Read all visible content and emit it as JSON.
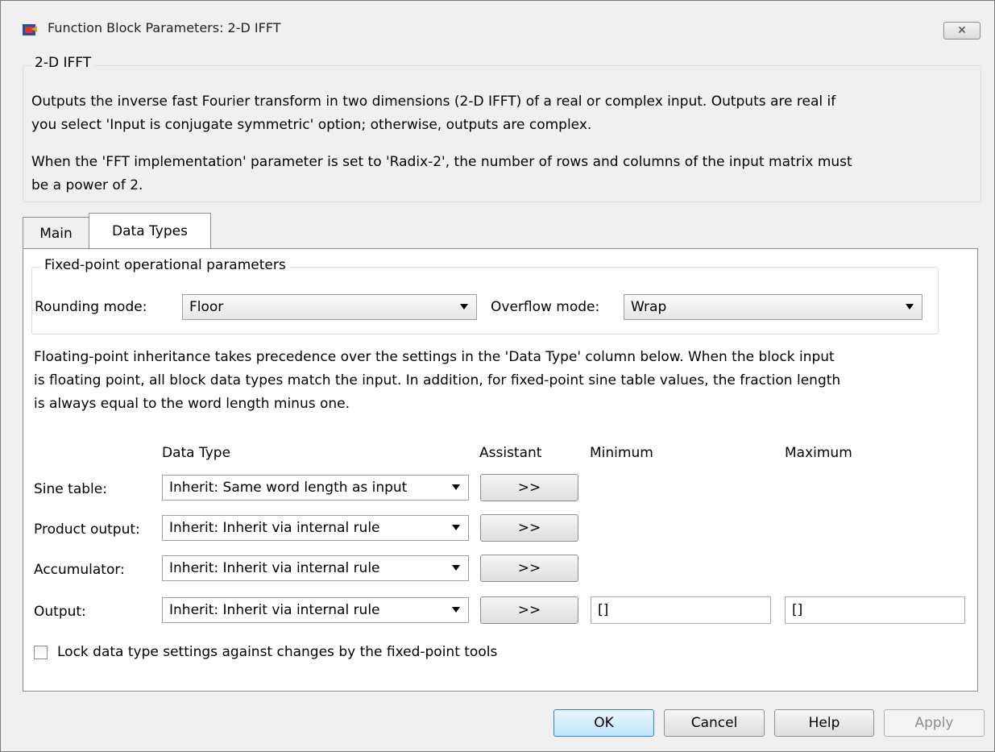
{
  "window": {
    "title": "Function Block Parameters: 2-D IFFT",
    "close_label": "✕"
  },
  "description": {
    "group_title": "2-D IFFT",
    "paragraph1_line1": "Outputs the inverse fast Fourier transform in two dimensions (2-D IFFT) of a real or complex input. Outputs are real if",
    "paragraph1_line2": "you select 'Input is conjugate symmetric' option; otherwise, outputs are complex.",
    "paragraph2_line1": "When the 'FFT implementation' parameter is set to 'Radix-2', the number of rows and columns of the input matrix must",
    "paragraph2_line2": "be a power of 2."
  },
  "tabs": [
    {
      "label": "Main"
    },
    {
      "label": "Data Types"
    }
  ],
  "fixed_point": {
    "group_title": "Fixed-point operational parameters",
    "rounding_label": "Rounding mode:",
    "rounding_value": "Floor",
    "overflow_label": "Overflow mode:",
    "overflow_value": "Wrap"
  },
  "info": {
    "line1": "Floating-point inheritance takes precedence over the settings in the 'Data Type' column below. When the block input",
    "line2": "is floating point, all block data types match the input. In addition, for fixed-point sine table values, the fraction length",
    "line3": "is always equal to the word length minus one."
  },
  "table": {
    "headers": {
      "data_type": "Data Type",
      "assistant": "Assistant",
      "minimum": "Minimum",
      "maximum": "Maximum"
    },
    "rows": [
      {
        "label": "Sine table:",
        "data_type": "Inherit: Same word length as input",
        "assistant": ">>"
      },
      {
        "label": "Product output:",
        "data_type": "Inherit: Inherit via internal rule",
        "assistant": ">>"
      },
      {
        "label": "Accumulator:",
        "data_type": "Inherit: Inherit via internal rule",
        "assistant": ">>"
      },
      {
        "label": "Output:",
        "data_type": "Inherit: Inherit via internal rule",
        "assistant": ">>",
        "minimum": "[]",
        "maximum": "[]"
      }
    ]
  },
  "lock": {
    "label": "Lock data type settings against changes by the fixed-point tools",
    "checked": false
  },
  "buttons": {
    "ok": "OK",
    "cancel": "Cancel",
    "help": "Help",
    "apply": "Apply"
  }
}
